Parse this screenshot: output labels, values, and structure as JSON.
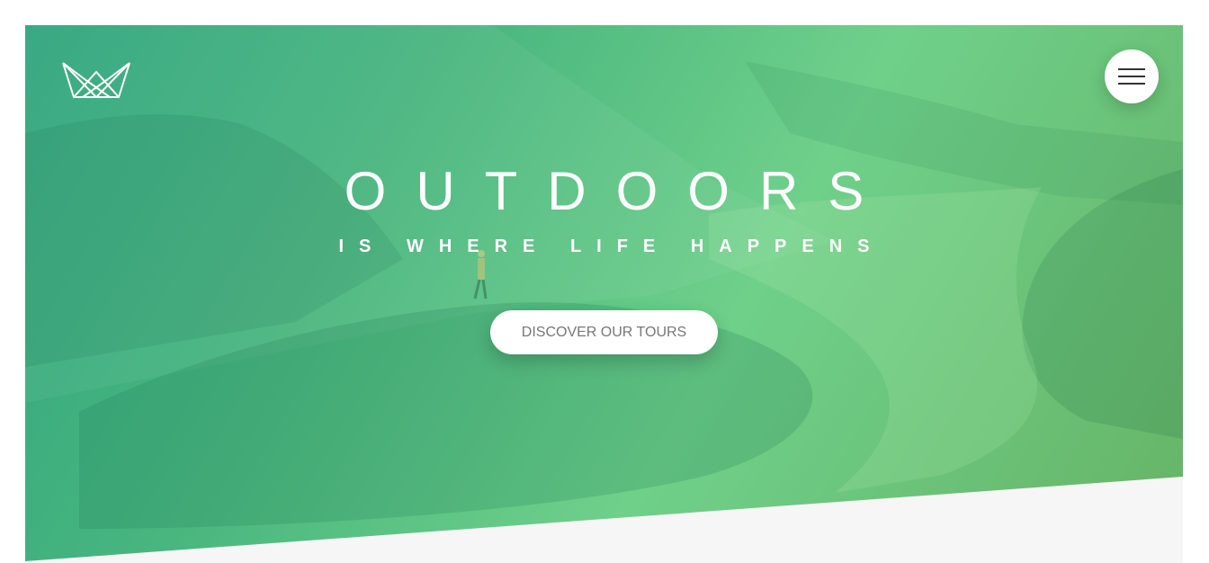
{
  "hero": {
    "title": "OUTDOORS",
    "subtitle": "IS WHERE LIFE HAPPENS",
    "cta_label": "DISCOVER OUR TOURS"
  },
  "header": {
    "logo_icon": "crown-icon",
    "menu_icon": "hamburger-menu-icon"
  },
  "colors": {
    "gradient_start": "#2fa57e",
    "gradient_end": "#66b466",
    "page_background": "#f6f6f6",
    "button_text": "#777777"
  }
}
